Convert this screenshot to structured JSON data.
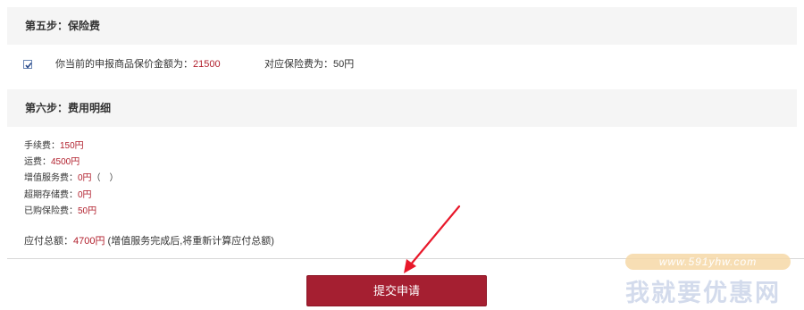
{
  "step5": {
    "title": "第五步：保险费",
    "checkbox_checked": true,
    "declared_label": "你当前的申报商品保价金额为：",
    "declared_value": "21500",
    "fee_label": "对应保险费为：",
    "fee_value": "50円"
  },
  "step6": {
    "title": "第六步：费用明细",
    "fees": [
      {
        "label": "手续费：",
        "value": "150円",
        "extra": ""
      },
      {
        "label": "运费：",
        "value": "4500円",
        "extra": ""
      },
      {
        "label": "增值服务费：",
        "value": "0円",
        "extra": "（　）"
      },
      {
        "label": "超期存储费：",
        "value": "0円",
        "extra": ""
      },
      {
        "label": "已购保险费：",
        "value": "50円",
        "extra": ""
      }
    ],
    "total_label": "应付总额：",
    "total_value": "4700円",
    "total_note": "(增值服务完成后,将重新计算应付总额)"
  },
  "submit_label": "提交申请",
  "watermark": {
    "url": "www.591yhw.com",
    "name": "我就要优惠网"
  },
  "colors": {
    "accent_red": "#b11f2c",
    "button_red": "#a51f31",
    "section_bg": "#f5f5f5",
    "arrow_red": "#e8182a"
  }
}
